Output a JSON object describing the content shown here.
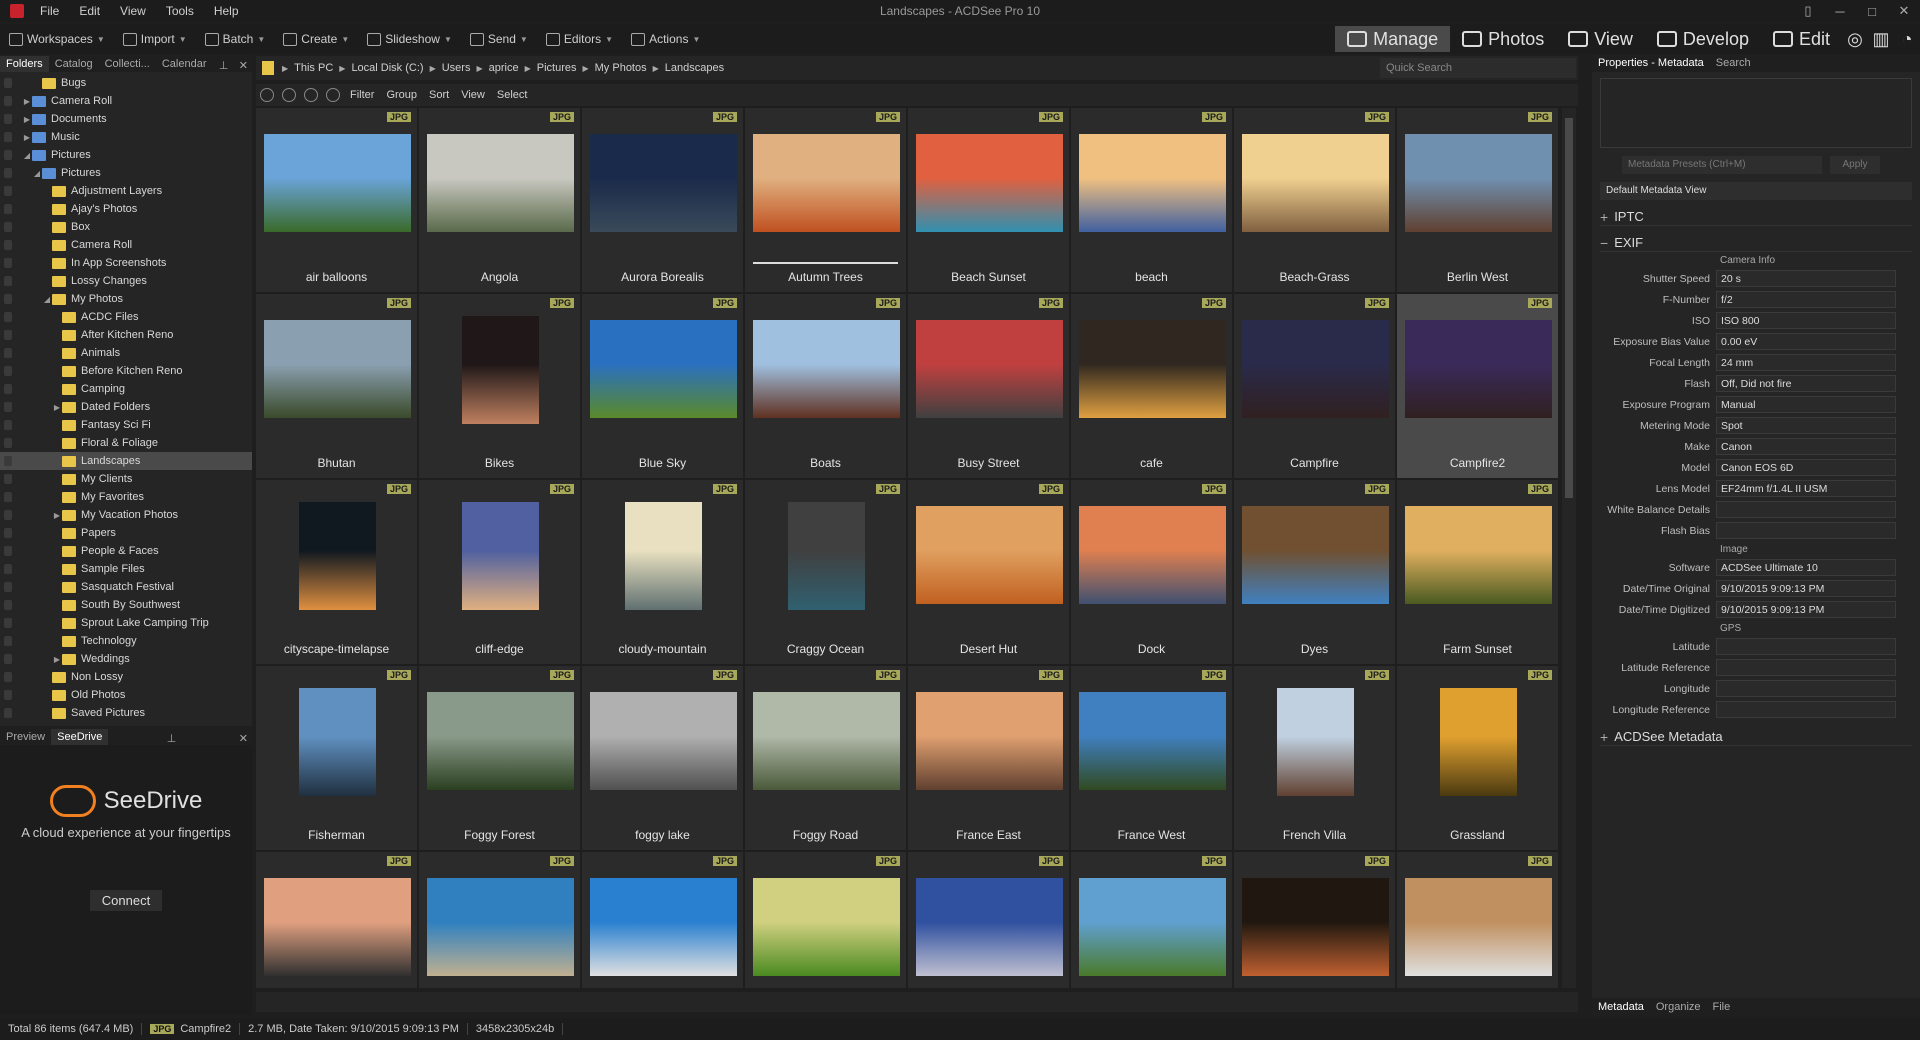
{
  "app": {
    "title": "Landscapes - ACDSee Pro 10"
  },
  "menu": [
    "File",
    "Edit",
    "View",
    "Tools",
    "Help"
  ],
  "toolbar": [
    {
      "label": "Workspaces",
      "icon": "workspaces-icon"
    },
    {
      "label": "Import",
      "icon": "import-icon"
    },
    {
      "label": "Batch",
      "icon": "batch-icon"
    },
    {
      "label": "Create",
      "icon": "create-icon"
    },
    {
      "label": "Slideshow",
      "icon": "slideshow-icon"
    },
    {
      "label": "Send",
      "icon": "send-icon"
    },
    {
      "label": "Editors",
      "icon": "editors-icon"
    },
    {
      "label": "Actions",
      "icon": "actions-icon"
    }
  ],
  "modes": [
    {
      "label": "Manage",
      "active": true
    },
    {
      "label": "Photos",
      "active": false
    },
    {
      "label": "View",
      "active": false
    },
    {
      "label": "Develop",
      "active": false
    },
    {
      "label": "Edit",
      "active": false
    }
  ],
  "left_tabs": [
    "Folders",
    "Catalog",
    "Collecti...",
    "Calendar"
  ],
  "tree": [
    {
      "label": "Bugs",
      "level": 3,
      "arrow": "",
      "color": "yellow"
    },
    {
      "label": "Camera Roll",
      "level": 2,
      "arrow": "right",
      "color": "blue"
    },
    {
      "label": "Documents",
      "level": 2,
      "arrow": "right",
      "color": "blue"
    },
    {
      "label": "Music",
      "level": 2,
      "arrow": "right",
      "color": "blue"
    },
    {
      "label": "Pictures",
      "level": 2,
      "arrow": "down",
      "color": "blue"
    },
    {
      "label": "Pictures",
      "level": 3,
      "arrow": "down",
      "color": "blue"
    },
    {
      "label": "Adjustment Layers",
      "level": 4,
      "arrow": "",
      "color": "yellow"
    },
    {
      "label": "Ajay's Photos",
      "level": 4,
      "arrow": "",
      "color": "yellow"
    },
    {
      "label": "Box",
      "level": 4,
      "arrow": "",
      "color": "yellow"
    },
    {
      "label": "Camera Roll",
      "level": 4,
      "arrow": "",
      "color": "yellow"
    },
    {
      "label": "In App Screenshots",
      "level": 4,
      "arrow": "",
      "color": "yellow"
    },
    {
      "label": "Lossy Changes",
      "level": 4,
      "arrow": "",
      "color": "yellow"
    },
    {
      "label": "My Photos",
      "level": 4,
      "arrow": "down",
      "color": "yellow"
    },
    {
      "label": "ACDC Files",
      "level": 5,
      "arrow": "",
      "color": "yellow"
    },
    {
      "label": "After Kitchen Reno",
      "level": 5,
      "arrow": "",
      "color": "yellow"
    },
    {
      "label": "Animals",
      "level": 5,
      "arrow": "",
      "color": "yellow"
    },
    {
      "label": "Before Kitchen Reno",
      "level": 5,
      "arrow": "",
      "color": "yellow"
    },
    {
      "label": "Camping",
      "level": 5,
      "arrow": "",
      "color": "yellow"
    },
    {
      "label": "Dated Folders",
      "level": 5,
      "arrow": "right",
      "color": "yellow"
    },
    {
      "label": "Fantasy Sci Fi",
      "level": 5,
      "arrow": "",
      "color": "yellow"
    },
    {
      "label": "Floral & Foliage",
      "level": 5,
      "arrow": "",
      "color": "yellow"
    },
    {
      "label": "Landscapes",
      "level": 5,
      "arrow": "",
      "color": "yellow",
      "selected": true
    },
    {
      "label": "My Clients",
      "level": 5,
      "arrow": "",
      "color": "yellow"
    },
    {
      "label": "My Favorites",
      "level": 5,
      "arrow": "",
      "color": "yellow"
    },
    {
      "label": "My Vacation Photos",
      "level": 5,
      "arrow": "right",
      "color": "yellow"
    },
    {
      "label": "Papers",
      "level": 5,
      "arrow": "",
      "color": "yellow"
    },
    {
      "label": "People & Faces",
      "level": 5,
      "arrow": "",
      "color": "yellow"
    },
    {
      "label": "Sample Files",
      "level": 5,
      "arrow": "",
      "color": "yellow"
    },
    {
      "label": "Sasquatch Festival",
      "level": 5,
      "arrow": "",
      "color": "yellow"
    },
    {
      "label": "South By Southwest",
      "level": 5,
      "arrow": "",
      "color": "yellow"
    },
    {
      "label": "Sprout Lake Camping Trip",
      "level": 5,
      "arrow": "",
      "color": "yellow"
    },
    {
      "label": "Technology",
      "level": 5,
      "arrow": "",
      "color": "yellow"
    },
    {
      "label": "Weddings",
      "level": 5,
      "arrow": "right",
      "color": "yellow"
    },
    {
      "label": "Non Lossy",
      "level": 4,
      "arrow": "",
      "color": "yellow"
    },
    {
      "label": "Old Photos",
      "level": 4,
      "arrow": "",
      "color": "yellow"
    },
    {
      "label": "Saved Pictures",
      "level": 4,
      "arrow": "",
      "color": "yellow"
    }
  ],
  "preview_tabs": [
    "Preview",
    "SeeDrive"
  ],
  "seedrive": {
    "name": "SeeDrive",
    "tagline": "A cloud experience at your fingertips",
    "connect": "Connect"
  },
  "breadcrumb": [
    "This PC",
    "Local Disk (C:)",
    "Users",
    "aprice",
    "Pictures",
    "My Photos",
    "Landscapes"
  ],
  "search_placeholder": "Quick Search",
  "filterbar": [
    "Filter",
    "Group",
    "Sort",
    "View",
    "Select"
  ],
  "badge": "JPG",
  "thumbs": [
    {
      "name": "air balloons",
      "c1": "#6aa4d8",
      "c2": "#3a6a2a"
    },
    {
      "name": "Angola",
      "c1": "#c8c8c0",
      "c2": "#5a6a4a"
    },
    {
      "name": "Aurora Borealis",
      "c1": "#1a2a4a",
      "c2": "#3a4a5a"
    },
    {
      "name": "Autumn Trees",
      "c1": "#e0b080",
      "c2": "#c05020",
      "underline": true
    },
    {
      "name": "Beach Sunset",
      "c1": "#e06040",
      "c2": "#3090b0"
    },
    {
      "name": "beach",
      "c1": "#f0c080",
      "c2": "#4060a0"
    },
    {
      "name": "Beach-Grass",
      "c1": "#f0d090",
      "c2": "#806040"
    },
    {
      "name": "Berlin West",
      "c1": "#7090b0",
      "c2": "#604030"
    },
    {
      "name": "Bhutan",
      "c1": "#8aa0b0",
      "c2": "#3a4a2a"
    },
    {
      "name": "Bikes",
      "c1": "#201818",
      "c2": "#c08060",
      "tall": true
    },
    {
      "name": "Blue Sky",
      "c1": "#2a70c0",
      "c2": "#5a8a2a"
    },
    {
      "name": "Boats",
      "c1": "#a0c0e0",
      "c2": "#603020"
    },
    {
      "name": "Busy Street",
      "c1": "#c04040",
      "c2": "#404040"
    },
    {
      "name": "cafe",
      "c1": "#302820",
      "c2": "#e0a040"
    },
    {
      "name": "Campfire",
      "c1": "#2a2a4a",
      "c2": "#302020"
    },
    {
      "name": "Campfire2",
      "c1": "#3a2a5a",
      "c2": "#302020",
      "selected": true
    },
    {
      "name": "cityscape-timelapse",
      "c1": "#101820",
      "c2": "#e09040",
      "tall": true
    },
    {
      "name": "cliff-edge",
      "c1": "#5060a0",
      "c2": "#e0b080",
      "tall": true
    },
    {
      "name": "cloudy-mountain",
      "c1": "#e8e0c0",
      "c2": "#607070",
      "tall": true
    },
    {
      "name": "Craggy Ocean",
      "c1": "#404040",
      "c2": "#306070",
      "tall": true
    },
    {
      "name": "Desert Hut",
      "c1": "#e0a060",
      "c2": "#c06020"
    },
    {
      "name": "Dock",
      "c1": "#e08050",
      "c2": "#405070"
    },
    {
      "name": "Dyes",
      "c1": "#705030",
      "c2": "#4080c0"
    },
    {
      "name": "Farm Sunset",
      "c1": "#e0b060",
      "c2": "#4a5a20"
    },
    {
      "name": "Fisherman",
      "c1": "#6090c0",
      "c2": "#203040",
      "tall": true
    },
    {
      "name": "Foggy Forest",
      "c1": "#8a9a8a",
      "c2": "#2a4020"
    },
    {
      "name": "foggy lake",
      "c1": "#b0b0b0",
      "c2": "#505050"
    },
    {
      "name": "Foggy Road",
      "c1": "#b0b8a8",
      "c2": "#4a5a3a"
    },
    {
      "name": "France East",
      "c1": "#e0a070",
      "c2": "#604030"
    },
    {
      "name": "France West",
      "c1": "#4080c0",
      "c2": "#304a20"
    },
    {
      "name": "French Villa",
      "c1": "#c0d0e0",
      "c2": "#604030",
      "tall": true
    },
    {
      "name": "Grassland",
      "c1": "#e0a030",
      "c2": "#4a3a10",
      "tall": true
    },
    {
      "name": "",
      "c1": "#e0a080",
      "c2": "#303030"
    },
    {
      "name": "",
      "c1": "#3080c0",
      "c2": "#c0b090"
    },
    {
      "name": "",
      "c1": "#2a80d0",
      "c2": "#e0e0e0"
    },
    {
      "name": "",
      "c1": "#d0d080",
      "c2": "#4a8a20"
    },
    {
      "name": "",
      "c1": "#3050a0",
      "c2": "#c0c0d0"
    },
    {
      "name": "",
      "c1": "#60a0d0",
      "c2": "#4a7a2a"
    },
    {
      "name": "",
      "c1": "#201810",
      "c2": "#c06030"
    },
    {
      "name": "",
      "c1": "#c09060",
      "c2": "#e0e0e0"
    }
  ],
  "right_tabs": [
    "Properties - Metadata",
    "Search"
  ],
  "presets": {
    "placeholder": "Metadata Presets (Ctrl+M)",
    "apply": "Apply"
  },
  "metadata_view": "Default Metadata View",
  "sections": {
    "iptc": "IPTC",
    "exif": "EXIF",
    "acdsee": "ACDSee Metadata"
  },
  "exif": {
    "camera_info": "Camera Info",
    "camera_fields": [
      {
        "label": "Shutter Speed",
        "value": "20 s"
      },
      {
        "label": "F-Number",
        "value": "f/2"
      },
      {
        "label": "ISO",
        "value": "ISO 800"
      },
      {
        "label": "Exposure Bias Value",
        "value": "0.00 eV"
      },
      {
        "label": "Focal Length",
        "value": "24 mm"
      },
      {
        "label": "Flash",
        "value": "Off, Did not fire"
      },
      {
        "label": "Exposure Program",
        "value": "Manual"
      },
      {
        "label": "Metering Mode",
        "value": "Spot"
      },
      {
        "label": "Make",
        "value": "Canon"
      },
      {
        "label": "Model",
        "value": "Canon EOS 6D"
      },
      {
        "label": "Lens Model",
        "value": "EF24mm f/1.4L II USM"
      },
      {
        "label": "White Balance Details",
        "value": ""
      },
      {
        "label": "Flash Bias",
        "value": ""
      }
    ],
    "image": "Image",
    "image_fields": [
      {
        "label": "Software",
        "value": "ACDSee Ultimate 10"
      },
      {
        "label": "Date/Time Original",
        "value": "9/10/2015 9:09:13 PM"
      },
      {
        "label": "Date/Time Digitized",
        "value": "9/10/2015 9:09:13 PM"
      }
    ],
    "gps": "GPS",
    "gps_fields": [
      {
        "label": "Latitude",
        "value": ""
      },
      {
        "label": "Latitude Reference",
        "value": ""
      },
      {
        "label": "Longitude",
        "value": ""
      },
      {
        "label": "Longitude Reference",
        "value": ""
      }
    ]
  },
  "right_bottom_tabs": [
    "Metadata",
    "Organize",
    "File"
  ],
  "status": {
    "total": "Total 86 items  (647.4 MB)",
    "jpg": "JPG",
    "filename": "Campfire2",
    "info": "2.7 MB, Date Taken: 9/10/2015 9:09:13 PM",
    "dims": "3458x2305x24b"
  }
}
